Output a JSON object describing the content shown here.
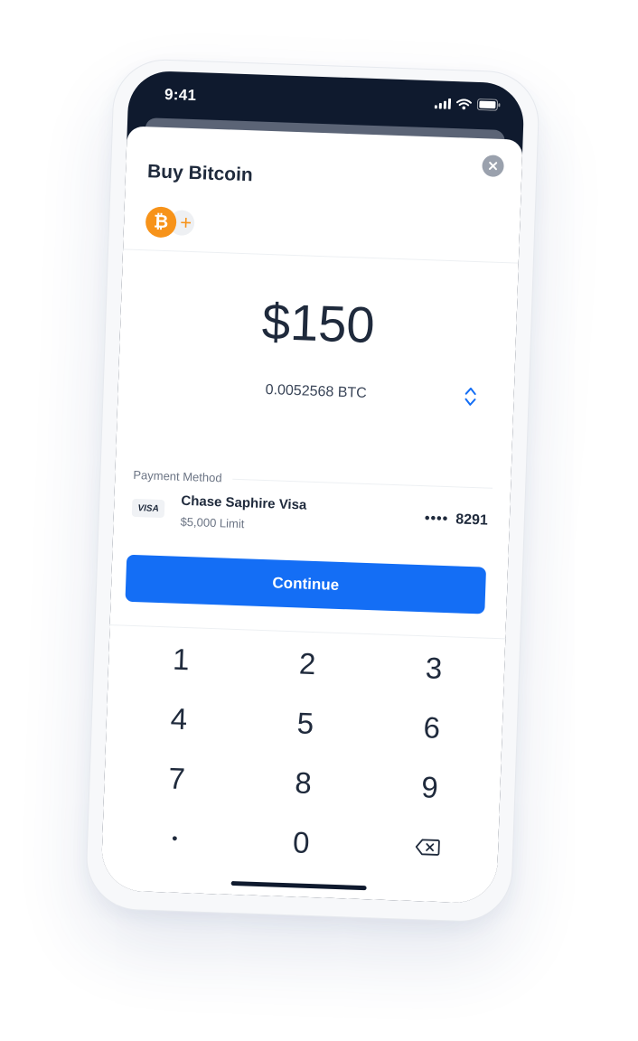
{
  "status_bar": {
    "time": "9:41",
    "icons": [
      "cellular-signal-icon",
      "wifi-icon",
      "battery-icon"
    ]
  },
  "sheet": {
    "title": "Buy Bitcoin",
    "close_icon": "close-icon",
    "asset_symbol": "₿",
    "add_symbol": "+",
    "accent_color": "#f7931a"
  },
  "amount": {
    "fiat": "$150",
    "crypto": "0.0052568 BTC",
    "swap_icon": "swap-vertical-icon"
  },
  "payment": {
    "label": "Payment Method",
    "card_brand": "VISA",
    "card_name": "Chase Saphire Visa",
    "card_limit": "$5,000 Limit",
    "card_dots": "••••",
    "card_last4": "8291"
  },
  "continue_button": {
    "label": "Continue",
    "color": "#146ef5"
  },
  "keypad": {
    "keys": [
      "1",
      "2",
      "3",
      "4",
      "5",
      "6",
      "7",
      "8",
      "9",
      "•",
      "0"
    ],
    "backspace_icon": "backspace-icon"
  }
}
